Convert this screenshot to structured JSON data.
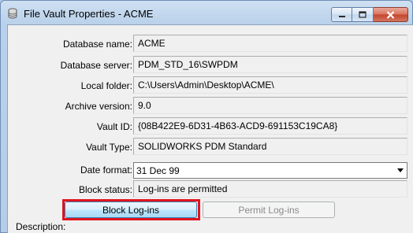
{
  "window": {
    "title": "File Vault Properties - ACME",
    "icon": "database-icon",
    "controls": {
      "minimize": "minimize-icon",
      "maximize": "maximize-icon",
      "close": "close-icon"
    }
  },
  "fields": {
    "database_name": {
      "label": "Database name:",
      "value": "ACME"
    },
    "database_server": {
      "label": "Database server:",
      "value": "PDM_STD_16\\SWPDM"
    },
    "local_folder": {
      "label": "Local folder:",
      "value": "C:\\Users\\Admin\\Desktop\\ACME\\"
    },
    "archive_version": {
      "label": "Archive version:",
      "value": "9.0"
    },
    "vault_id": {
      "label": "Vault ID:",
      "value": "{08B422E9-6D31-4B63-ACD9-691153C19CA8}"
    },
    "vault_type": {
      "label": "Vault Type:",
      "value": "SOLIDWORKS PDM Standard"
    },
    "date_format": {
      "label": "Date format:",
      "value": "31 Dec 99"
    },
    "block_status": {
      "label": "Block status:",
      "value": "Log-ins are permitted"
    }
  },
  "buttons": {
    "block_logins": "Block Log-ins",
    "permit_logins": "Permit Log-ins"
  },
  "description": {
    "label": "Description:"
  },
  "colors": {
    "highlight": "#e0141e",
    "close_button": "#c4432b"
  }
}
